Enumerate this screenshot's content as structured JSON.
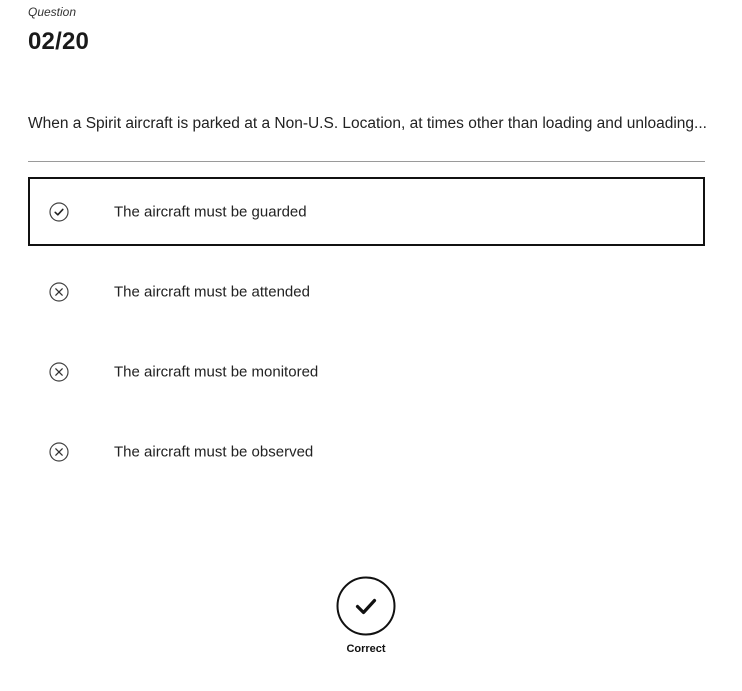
{
  "header": {
    "label": "Question",
    "number": "02/20"
  },
  "question": {
    "text": "When a Spirit aircraft is parked at a Non-U.S. Location, at times other than loading and unloading..."
  },
  "options": [
    {
      "label": "The aircraft must be guarded",
      "icon": "check-circle-icon",
      "selected": true
    },
    {
      "label": "The aircraft must be attended",
      "icon": "x-circle-icon",
      "selected": false
    },
    {
      "label": "The aircraft must be monitored",
      "icon": "x-circle-icon",
      "selected": false
    },
    {
      "label": "The aircraft must be observed",
      "icon": "x-circle-icon",
      "selected": false
    }
  ],
  "result": {
    "icon": "check-circle-icon",
    "label": "Correct"
  }
}
